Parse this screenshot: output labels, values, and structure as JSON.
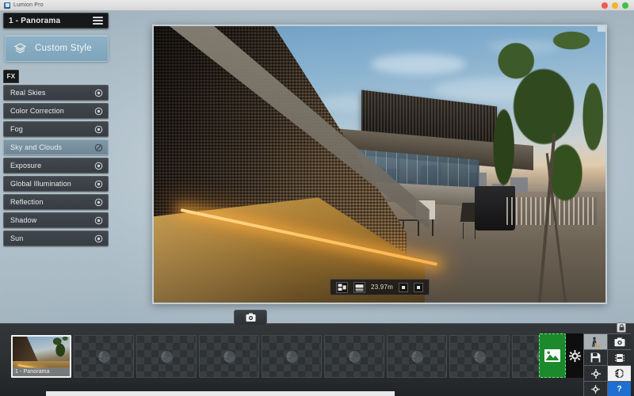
{
  "window": {
    "app_title": "Lumion Pro",
    "controls": {
      "close": "close",
      "minimize": "minimize",
      "maximize": "maximize"
    }
  },
  "sidebar": {
    "scene_title": "1 - Panorama",
    "menu_icon": "hamburger-icon",
    "style_button": {
      "label": "Custom Style",
      "icon": "layers-diamond-icon"
    },
    "fx_tab": {
      "label": "FX"
    },
    "effects": [
      {
        "label": "Real Skies",
        "visible": true,
        "selected": false,
        "eye_icon": "eye-icon"
      },
      {
        "label": "Color Correction",
        "visible": true,
        "selected": false,
        "eye_icon": "eye-icon"
      },
      {
        "label": "Fog",
        "visible": true,
        "selected": false,
        "eye_icon": "eye-icon"
      },
      {
        "label": "Sky and Clouds",
        "visible": false,
        "selected": true,
        "eye_icon": "eye-off-icon"
      },
      {
        "label": "Exposure",
        "visible": true,
        "selected": false,
        "eye_icon": "eye-icon"
      },
      {
        "label": "Global Illumination",
        "visible": true,
        "selected": false,
        "eye_icon": "eye-icon"
      },
      {
        "label": "Reflection",
        "visible": true,
        "selected": false,
        "eye_icon": "eye-icon"
      },
      {
        "label": "Shadow",
        "visible": true,
        "selected": false,
        "eye_icon": "eye-icon"
      },
      {
        "label": "Sun",
        "visible": true,
        "selected": false,
        "eye_icon": "eye-icon"
      }
    ]
  },
  "viewport": {
    "description": "Rooftop terrace architectural render at sunset with textured brick wall, glass building, city skyline, trees and wet reflective deck",
    "hud": {
      "layout_icon": "split-view-icon",
      "camera_height_icon": "camera-height-icon",
      "camera_height_value": "23.97m",
      "decrease_icon": "minus-icon",
      "increase_icon": "plus-icon"
    }
  },
  "bottom": {
    "capture_button": {
      "icon": "camera-icon",
      "label": ""
    },
    "slots": [
      {
        "index": 1,
        "label": "1 - Panorama",
        "filled": true,
        "icon": ""
      },
      {
        "index": 2,
        "label": "",
        "filled": false,
        "icon": "globe-icon"
      },
      {
        "index": 3,
        "label": "",
        "filled": false,
        "icon": "globe-icon"
      },
      {
        "index": 4,
        "label": "",
        "filled": false,
        "icon": "globe-icon"
      },
      {
        "index": 5,
        "label": "",
        "filled": false,
        "icon": "globe-icon"
      },
      {
        "index": 6,
        "label": "",
        "filled": false,
        "icon": "globe-icon"
      },
      {
        "index": 7,
        "label": "",
        "filled": false,
        "icon": "globe-icon"
      },
      {
        "index": 8,
        "label": "",
        "filled": false,
        "icon": "globe-icon"
      },
      {
        "index": 9,
        "label": "",
        "filled": false,
        "icon": "globe-icon"
      }
    ],
    "render_button": {
      "icon": "render-image-icon",
      "label": ""
    },
    "settings_button": {
      "icon": "gear-icon",
      "label": ""
    },
    "modes": [
      {
        "name": "build-mode",
        "icon": "person-build-icon",
        "active": true
      },
      {
        "name": "photo-mode",
        "icon": "camera-icon",
        "active": false
      },
      {
        "name": "movie-mode",
        "icon": "film-strip-icon",
        "active": false
      },
      {
        "name": "save-scene",
        "icon": "floppy-disk-icon",
        "active": false
      },
      {
        "name": "panorama-mode",
        "icon": "panorama-360-icon",
        "active": true
      },
      {
        "name": "settings",
        "icon": "gear-icon",
        "active": false
      },
      {
        "name": "help",
        "icon": "question-mark-icon",
        "label": "?",
        "active": false
      }
    ],
    "lock_badge": {
      "icon": "lock-icon"
    }
  },
  "colors": {
    "accent_blue": "#7da4ba",
    "render_green": "#1a8a2a",
    "help_blue": "#1f6fd0",
    "panel_dark": "#373d42",
    "selected_row": "#7b93a1"
  }
}
